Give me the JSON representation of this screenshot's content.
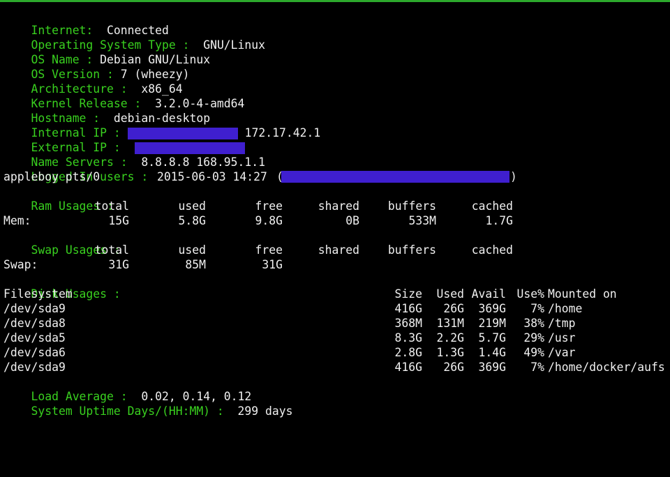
{
  "accent_color": "#39d01f",
  "redaction_color": "#3f1fcf",
  "internet": {
    "label": "Internet:",
    "value": "Connected"
  },
  "os_type": {
    "label": "Operating System Type :",
    "value": "GNU/Linux"
  },
  "os_name": {
    "label": "OS Name :",
    "value": "Debian GNU/Linux"
  },
  "os_version": {
    "label": "OS Version :",
    "value": "7 (wheezy)"
  },
  "architecture": {
    "label": "Architecture :",
    "value": "x86_64"
  },
  "kernel": {
    "label": "Kernel Release :",
    "value": "3.2.0-4-amd64"
  },
  "hostname": {
    "label": "Hostname :",
    "value": "debian-desktop"
  },
  "internal_ip": {
    "label": "Internal IP :",
    "value": "172.17.42.1"
  },
  "external_ip": {
    "label": "External IP :"
  },
  "name_servers": {
    "label": "Name Servers :",
    "value": "8.8.8.8 168.95.1.1"
  },
  "logged_in": {
    "label": "Logged In users :",
    "user": "appleboy pts/0",
    "time": "2015-06-03 14:27",
    "open": "(",
    "close": ")"
  },
  "ram": {
    "label": "Ram Usages :",
    "headers": [
      "total",
      "used",
      "free",
      "shared",
      "buffers",
      "cached"
    ],
    "row_label": "Mem:",
    "values": [
      "15G",
      "5.8G",
      "9.8G",
      "0B",
      "533M",
      "1.7G"
    ]
  },
  "swap": {
    "label": "Swap Usages :",
    "headers": [
      "total",
      "used",
      "free",
      "shared",
      "buffers",
      "cached"
    ],
    "row_label": "Swap:",
    "values": [
      "31G",
      "85M",
      "31G"
    ]
  },
  "disk": {
    "label": "Disk Usages :",
    "headers": [
      "Filesystem",
      "Size",
      "Used",
      "Avail",
      "Use%",
      "Mounted on"
    ],
    "rows": [
      [
        "/dev/sda9",
        "416G",
        "26G",
        "369G",
        "7%",
        "/home"
      ],
      [
        "/dev/sda8",
        "368M",
        "131M",
        "219M",
        "38%",
        "/tmp"
      ],
      [
        "/dev/sda5",
        "8.3G",
        "2.2G",
        "5.7G",
        "29%",
        "/usr"
      ],
      [
        "/dev/sda6",
        "2.8G",
        "1.3G",
        "1.4G",
        "49%",
        "/var"
      ],
      [
        "/dev/sda9",
        "416G",
        "26G",
        "369G",
        "7%",
        "/home/docker/aufs"
      ]
    ]
  },
  "load_average": {
    "label": "Load Average :",
    "value": "0.02, 0.14, 0.12"
  },
  "uptime": {
    "label": "System Uptime Days/(HH:MM) :",
    "value": "299 days"
  }
}
